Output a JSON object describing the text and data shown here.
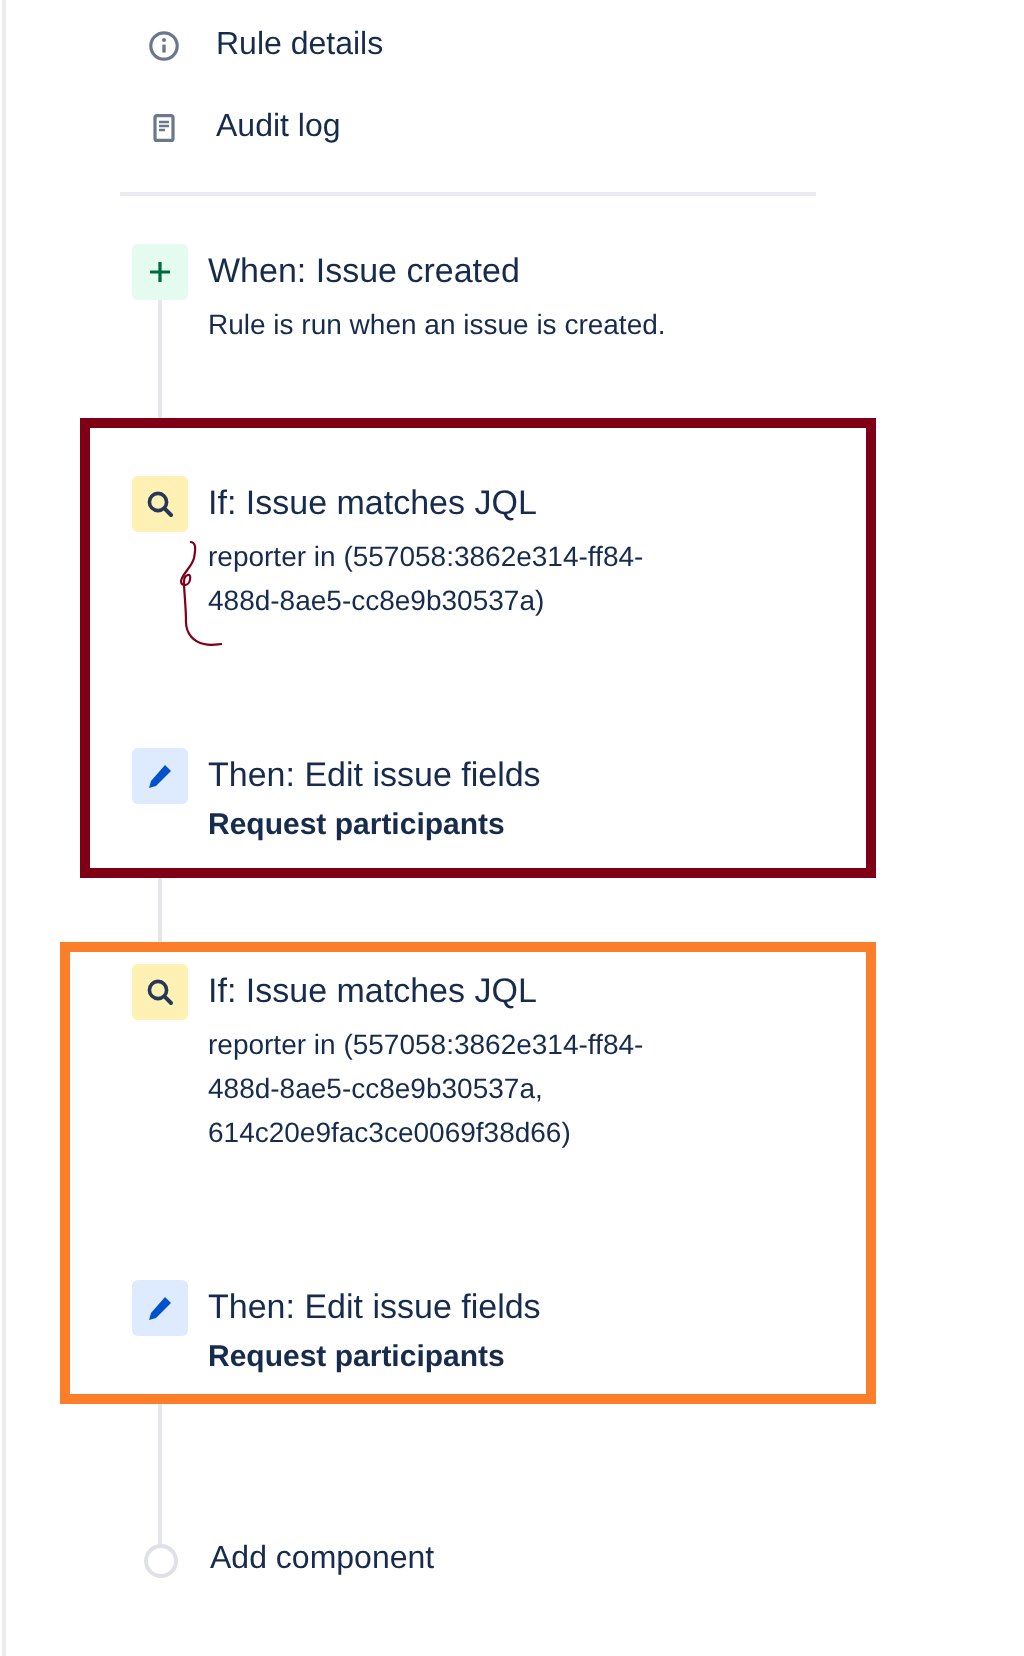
{
  "nav": [
    {
      "label": "Rule details",
      "kind": "info"
    },
    {
      "label": "Audit log",
      "kind": "document"
    }
  ],
  "trigger": {
    "kind": "trigger",
    "title": "When: Issue created",
    "lines": [
      "Rule is run when an issue is created."
    ]
  },
  "groups": [
    {
      "color": "#7f0016",
      "scribble": true,
      "steps": [
        {
          "kind": "condition",
          "title": "If: Issue matches JQL",
          "lines": [
            "reporter in (557058:3862e314-ff84-",
            "488d-8ae5-cc8e9b30537a)"
          ]
        },
        {
          "kind": "action",
          "title": "Then: Edit issue fields",
          "bold": "Request participants"
        }
      ]
    },
    {
      "color": "#fd7e28",
      "scribble": false,
      "steps": [
        {
          "kind": "condition",
          "title": "If: Issue matches JQL",
          "lines": [
            "reporter in (557058:3862e314-ff84-",
            "488d-8ae5-cc8e9b30537a,",
            "614c20e9fac3ce0069f38d66)"
          ]
        },
        {
          "kind": "action",
          "title": "Then: Edit issue fields",
          "bold": "Request participants"
        }
      ]
    }
  ],
  "add": {
    "label": "Add component"
  }
}
